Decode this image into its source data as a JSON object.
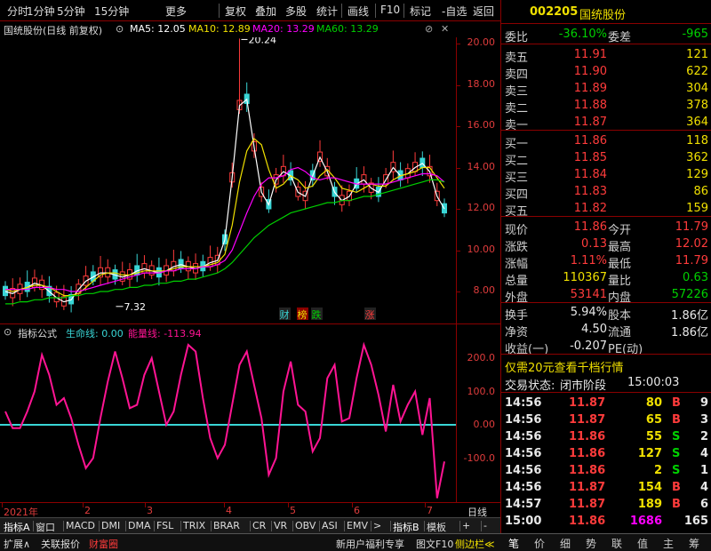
{
  "toolbar": {
    "items": [
      "分时",
      "1分钟",
      "5分钟",
      "15分钟",
      "更多",
      "复权",
      "叠加",
      "多股",
      "统计",
      "画线",
      "F10",
      "标记",
      "-自选",
      "返回"
    ]
  },
  "stock": {
    "code": "002205",
    "name": "国统股份"
  },
  "chart_header": {
    "title": "国统股份(日线 前复权)",
    "ma5": "MA5: 12.05",
    "ma10": "MA10: 12.89",
    "ma20": "MA20: 13.29",
    "ma60": "MA60: 13.29"
  },
  "colors": {
    "ma5": "#ffffff",
    "ma10": "#f0e000",
    "ma20": "#ff00ff",
    "ma60": "#00d000",
    "up": "#ff3b3b",
    "down": "#39d6d6",
    "energy": "#ff1493",
    "life": "#39d6d6"
  },
  "chart_data": [
    {
      "type": "candlestick",
      "title": "国统股份(日线 前复权)",
      "y_ticks": [
        "20.00",
        "18.00",
        "16.00",
        "14.00",
        "12.00",
        "10.00",
        "8.00"
      ],
      "ylim": [
        7,
        20.5
      ],
      "annotations": {
        "high": "20.24",
        "low": "7.32"
      },
      "markers": [
        "财",
        "榜",
        "跌",
        "涨"
      ],
      "x_ticks": [
        "2021年",
        "2",
        "3",
        "4",
        "5",
        "6",
        "7"
      ],
      "x_label": "日线",
      "series": [
        {
          "name": "MA5",
          "values": [
            8.0,
            7.9,
            8.1,
            8.2,
            8.4,
            8.3,
            8.0,
            7.7,
            7.5,
            7.6,
            8.1,
            8.5,
            8.7,
            8.9,
            8.9,
            8.8,
            8.7,
            8.8,
            9.0,
            9.1,
            9.0,
            8.9,
            9.0,
            9.2,
            9.3,
            9.2,
            9.1,
            9.2,
            9.4,
            9.5,
            10.5,
            13.5,
            17.0,
            17.3,
            15.0,
            12.8,
            12.2,
            13.4,
            13.8,
            13.6,
            12.8,
            12.6,
            13.6,
            14.5,
            13.8,
            12.8,
            12.4,
            12.6,
            13.2,
            13.4,
            13.0,
            12.8,
            13.4,
            14.0,
            13.6,
            13.7,
            14.0,
            14.2,
            13.8,
            12.6,
            12.0
          ]
        },
        {
          "name": "MA10",
          "values": [
            8.1,
            8.0,
            8.1,
            8.2,
            8.3,
            8.3,
            8.2,
            8.0,
            7.8,
            7.8,
            7.9,
            8.2,
            8.5,
            8.8,
            8.9,
            8.9,
            8.8,
            8.8,
            8.9,
            9.0,
            9.0,
            9.0,
            9.0,
            9.1,
            9.2,
            9.2,
            9.2,
            9.2,
            9.3,
            9.4,
            9.8,
            11.2,
            13.3,
            14.8,
            15.4,
            15.1,
            13.9,
            13.0,
            13.2,
            13.6,
            13.4,
            13.0,
            13.1,
            13.6,
            13.9,
            13.5,
            13.0,
            12.9,
            12.8,
            13.0,
            13.2,
            13.1,
            13.1,
            13.4,
            13.6,
            13.7,
            13.8,
            14.0,
            14.0,
            13.5,
            13.0
          ]
        },
        {
          "name": "MA20",
          "values": [
            8.1,
            8.1,
            8.1,
            8.1,
            8.2,
            8.2,
            8.2,
            8.1,
            8.1,
            8.0,
            8.0,
            8.1,
            8.2,
            8.3,
            8.4,
            8.5,
            8.6,
            8.7,
            8.8,
            8.9,
            8.9,
            8.9,
            9.0,
            9.0,
            9.1,
            9.1,
            9.1,
            9.2,
            9.2,
            9.3,
            9.5,
            10.0,
            10.9,
            11.8,
            12.6,
            13.2,
            13.5,
            13.5,
            13.6,
            13.9,
            14.0,
            13.8,
            13.5,
            13.4,
            13.5,
            13.5,
            13.4,
            13.3,
            13.2,
            13.2,
            13.2,
            13.2,
            13.2,
            13.3,
            13.4,
            13.5,
            13.6,
            13.7,
            13.7,
            13.6,
            13.3
          ]
        },
        {
          "name": "MA60",
          "values": [
            7.4,
            7.4,
            7.5,
            7.5,
            7.6,
            7.6,
            7.7,
            7.7,
            7.7,
            7.8,
            7.8,
            7.9,
            7.9,
            8.0,
            8.0,
            8.1,
            8.1,
            8.2,
            8.2,
            8.3,
            8.3,
            8.4,
            8.4,
            8.5,
            8.5,
            8.6,
            8.6,
            8.7,
            8.8,
            8.9,
            9.1,
            9.4,
            9.8,
            10.2,
            10.6,
            10.9,
            11.2,
            11.4,
            11.6,
            11.8,
            11.9,
            12.0,
            12.1,
            12.2,
            12.3,
            12.3,
            12.4,
            12.4,
            12.5,
            12.6,
            12.6,
            12.7,
            12.8,
            12.9,
            13.0,
            13.1,
            13.2,
            13.3,
            13.4,
            13.4,
            13.3
          ]
        }
      ]
    },
    {
      "type": "line",
      "title": "指标公式",
      "series_labels": {
        "life": "生命线: 0.00",
        "energy": "能量线: -113.94"
      },
      "y_ticks": [
        "200.0",
        "100.0",
        "0.00",
        "-100.0"
      ],
      "ylim": [
        -230,
        260
      ],
      "series": [
        {
          "name": "能量线",
          "values": [
            40,
            -10,
            -10,
            40,
            100,
            210,
            150,
            60,
            80,
            20,
            -60,
            -130,
            -100,
            20,
            130,
            220,
            140,
            50,
            60,
            150,
            200,
            100,
            0,
            40,
            150,
            240,
            220,
            80,
            -40,
            -100,
            -60,
            60,
            180,
            220,
            120,
            20,
            -150,
            -100,
            100,
            190,
            60,
            40,
            -80,
            -40,
            140,
            180,
            10,
            20,
            140,
            240,
            180,
            90,
            -20,
            120,
            10,
            60,
            100,
            -30,
            80,
            -220,
            -110
          ]
        },
        {
          "name": "生命线",
          "values": [
            0,
            0
          ]
        }
      ]
    }
  ],
  "ind_tabs": [
    "指标A",
    "窗口",
    "MACD",
    "DMI",
    "DMA",
    "FSL",
    "TRIX",
    "BRAR",
    "CR",
    "VR",
    "OBV",
    "ASI",
    "EMV",
    ">",
    "指标B",
    "模板",
    "+",
    "-"
  ],
  "bottom_bar": {
    "left": [
      "扩展∧",
      "关联报价",
      "财富圈"
    ],
    "promo": "新用户福利专享",
    "f10": "图文F10",
    "side": "侧边栏≪"
  },
  "right_panel": {
    "weibi_label": "委比",
    "weibi": "-36.10%",
    "weicha_label": "委差",
    "weicha": "-965",
    "asks": [
      {
        "label": "卖五",
        "price": "11.91",
        "vol": "121"
      },
      {
        "label": "卖四",
        "price": "11.90",
        "vol": "622"
      },
      {
        "label": "卖三",
        "price": "11.89",
        "vol": "304"
      },
      {
        "label": "卖二",
        "price": "11.88",
        "vol": "378"
      },
      {
        "label": "卖一",
        "price": "11.87",
        "vol": "364"
      }
    ],
    "bids": [
      {
        "label": "买一",
        "price": "11.86",
        "vol": "118"
      },
      {
        "label": "买二",
        "price": "11.85",
        "vol": "362"
      },
      {
        "label": "买三",
        "price": "11.84",
        "vol": "129"
      },
      {
        "label": "买四",
        "price": "11.83",
        "vol": "86"
      },
      {
        "label": "买五",
        "price": "11.82",
        "vol": "159"
      }
    ],
    "quote": [
      {
        "l1": "现价",
        "v1": "11.86",
        "l2": "今开",
        "v2": "11.79"
      },
      {
        "l1": "涨跌",
        "v1": "0.13",
        "l2": "最高",
        "v2": "12.02"
      },
      {
        "l1": "涨幅",
        "v1": "1.11%",
        "l2": "最低",
        "v2": "11.79"
      },
      {
        "l1": "总量",
        "v1": "110367",
        "l2": "量比",
        "v2": "0.63"
      },
      {
        "l1": "外盘",
        "v1": "53141",
        "l2": "内盘",
        "v2": "57226"
      }
    ],
    "fund": [
      {
        "l1": "换手",
        "v1": "5.94%",
        "l2": "股本",
        "v2": "1.86亿"
      },
      {
        "l1": "净资",
        "v1": "4.50",
        "l2": "流通",
        "v2": "1.86亿"
      },
      {
        "l1": "收益(一)",
        "v1": "-0.207",
        "l2": "PE(动)",
        "v2": ""
      }
    ],
    "promo_line": "仅需20元查看千档行情",
    "status_label": "交易状态:",
    "status_value": "闭市阶段",
    "status_time": "15:00:03",
    "ticks": [
      {
        "time": "14:56",
        "price": "11.87",
        "vol": "80",
        "bs": "B",
        "n": "9"
      },
      {
        "time": "14:56",
        "price": "11.87",
        "vol": "65",
        "bs": "B",
        "n": "3"
      },
      {
        "time": "14:56",
        "price": "11.86",
        "vol": "55",
        "bs": "S",
        "n": "2"
      },
      {
        "time": "14:56",
        "price": "11.86",
        "vol": "127",
        "bs": "S",
        "n": "4"
      },
      {
        "time": "14:56",
        "price": "11.86",
        "vol": "2",
        "bs": "S",
        "n": "1"
      },
      {
        "time": "14:56",
        "price": "11.87",
        "vol": "154",
        "bs": "B",
        "n": "4"
      },
      {
        "time": "14:57",
        "price": "11.87",
        "vol": "189",
        "bs": "B",
        "n": "6"
      },
      {
        "time": "15:00",
        "price": "11.86",
        "vol": "1686",
        "bs": "",
        "n": "165"
      }
    ],
    "bottom_tabs": [
      "笔",
      "价",
      "细",
      "势",
      "联",
      "值",
      "主",
      "筹"
    ]
  }
}
